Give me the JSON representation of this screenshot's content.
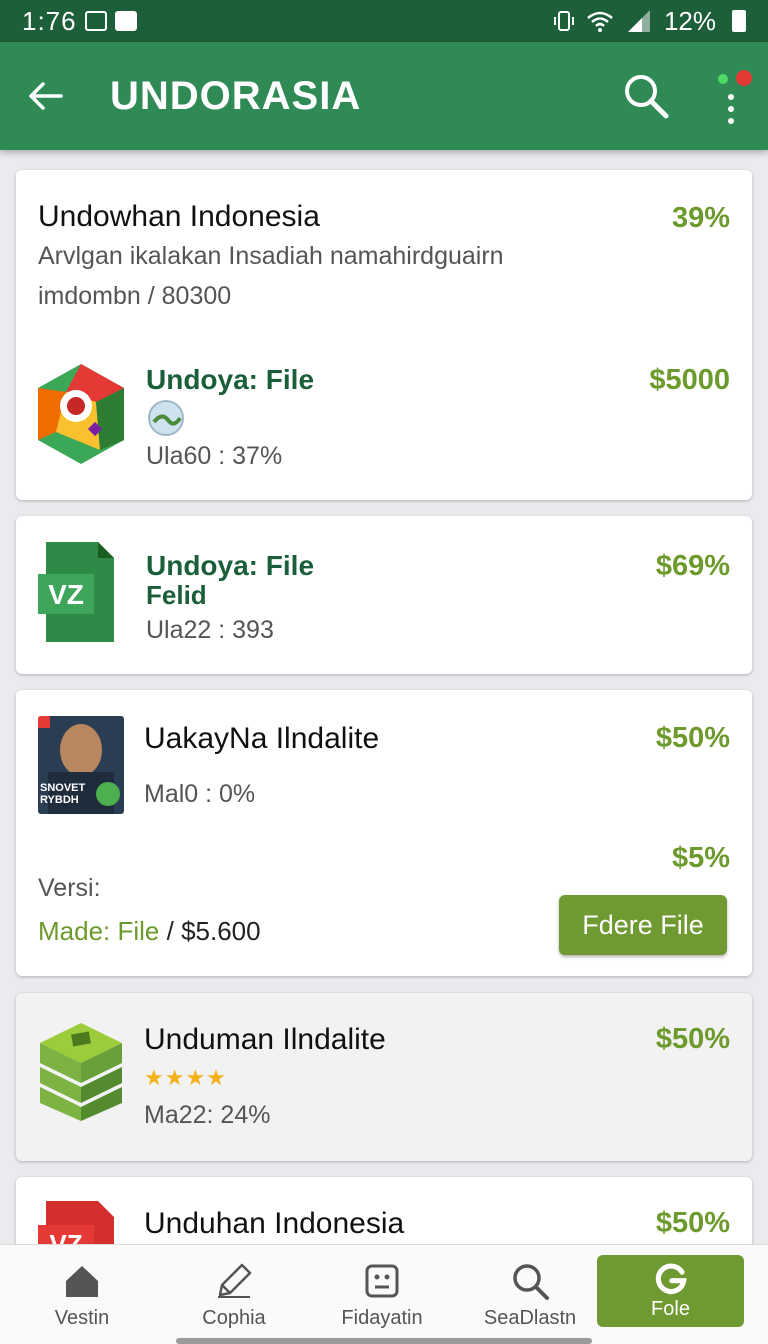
{
  "status_bar": {
    "time": "1:76",
    "battery": "12%"
  },
  "app_bar": {
    "title": "UNDORASIA"
  },
  "cards": [
    {
      "title": "Undowhan Indonesia",
      "percent": "39%",
      "description": "Arvlgan ikalakan Insadiah namahirdguairn",
      "meta": "imdombn / 80300",
      "app_name": "Undoya: File",
      "price": "$5000",
      "stat": "Ula60 : 37%"
    },
    {
      "app_name": "Undoya: File",
      "app_sub": "Felid",
      "percent": "$69%",
      "stat": "Ula22 : 393",
      "icon_text": "VZ"
    },
    {
      "title": "UakayNa Ilndalite",
      "percent": "$50%",
      "stat": "Mal0 : 0%",
      "price2": "$5%",
      "version_label": "Versi:",
      "made_label": "Made: File",
      "made_sep": " / ",
      "made_price": "$5.600",
      "button": "Fdere File",
      "avatar_text": "SNOVET RYBDH"
    },
    {
      "title": "Unduman Ilndalite",
      "percent": "$50%",
      "stars": "★★★★",
      "stat": "Ma22: 24%"
    },
    {
      "title": "Unduhan Indonesia",
      "percent": "$50%",
      "icon_text": "VZ"
    }
  ],
  "nav": [
    {
      "label": "Vestin",
      "icon": "home-icon"
    },
    {
      "label": "Cophia",
      "icon": "pencil-icon"
    },
    {
      "label": "Fidayatin",
      "icon": "face-icon"
    },
    {
      "label": "SeaDlastn",
      "icon": "search-icon"
    },
    {
      "label": "Fole",
      "icon": "g-logo-icon"
    }
  ],
  "colors": {
    "status": "#1d5f38",
    "appbar": "#2f8a55",
    "accent": "#6e9a31",
    "price": "#6d9a2c"
  }
}
